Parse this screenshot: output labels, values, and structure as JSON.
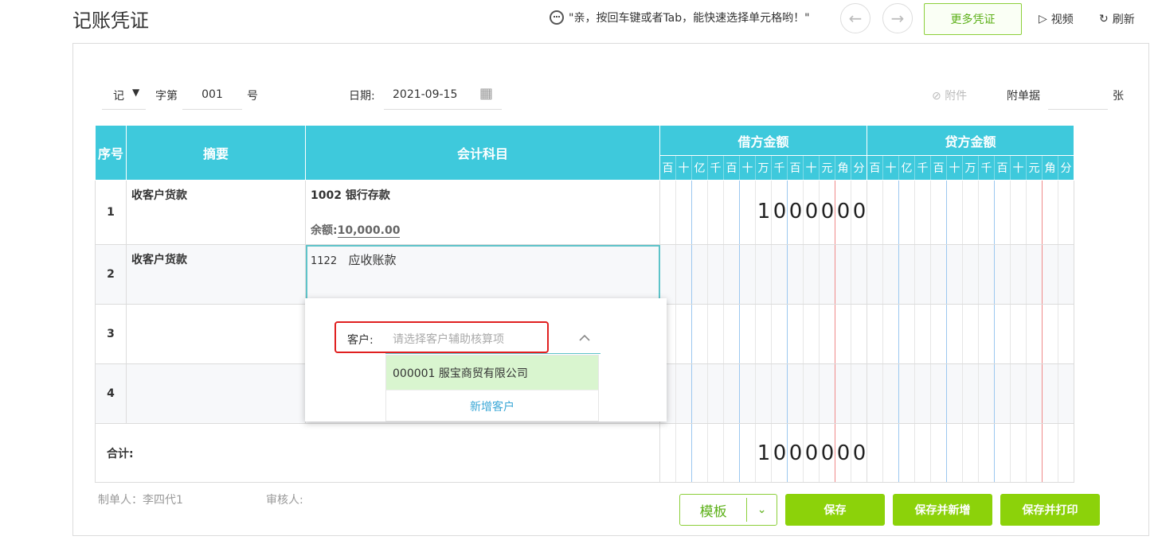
{
  "page": {
    "title": "记账凭证"
  },
  "tip": {
    "text": "\"亲，按回车键或者Tab，能快速选择单元格哟！\""
  },
  "toolbar": {
    "more": "更多凭证",
    "video": "视频",
    "refresh": "刷新"
  },
  "voucher": {
    "type": "记",
    "zi_di": "字第",
    "number": "001",
    "hao": "号",
    "date_label": "日期:",
    "date": "2021-09-15",
    "attach_label": "附件",
    "attach_count_label": "附单据",
    "attach_unit": "张"
  },
  "table": {
    "headers": {
      "seq": "序号",
      "summary": "摘要",
      "account": "会计科目",
      "debit": "借方金额",
      "credit": "贷方金额"
    },
    "digits": [
      "百",
      "十",
      "亿",
      "千",
      "百",
      "十",
      "万",
      "千",
      "百",
      "十",
      "元",
      "角",
      "分"
    ],
    "rows": [
      {
        "seq": "1",
        "summary": "收客户货款",
        "account": "1002 银行存款",
        "balance_label": "余额:",
        "balance": "10,000.00",
        "debit": "1000000"
      },
      {
        "seq": "2",
        "summary": "收客户货款",
        "account_code": "1122",
        "account_name": "应收账款"
      },
      {
        "seq": "3"
      },
      {
        "seq": "4"
      }
    ],
    "total_label": "合计:",
    "total_debit": "1000000"
  },
  "dropdown": {
    "label": "客户:",
    "placeholder": "请选择客户辅助核算项",
    "option": "000001 服宝商贸有限公司",
    "add": "新增客户"
  },
  "footer": {
    "maker": "制单人：李四代1",
    "reviewer": "审核人:"
  },
  "buttons": {
    "template": "模板",
    "save": "保存",
    "save_new": "保存并新增",
    "save_print": "保存并打印"
  },
  "colors": {
    "header": "#3ec9dc",
    "accent_green": "#8cd20a",
    "highlight": "#e02020"
  }
}
